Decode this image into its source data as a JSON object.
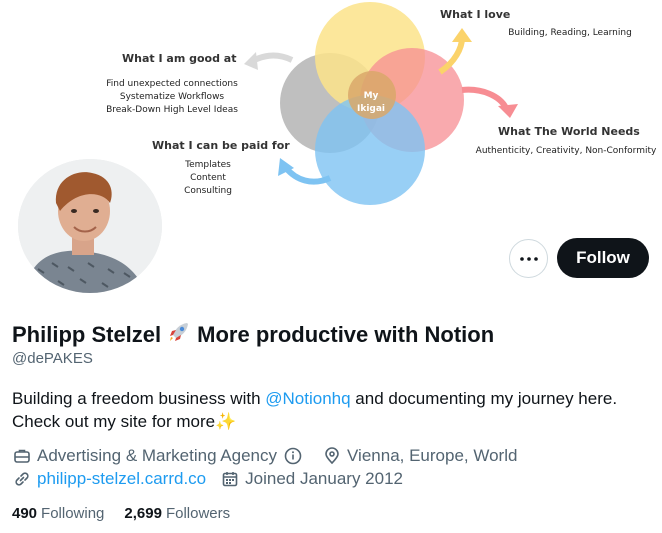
{
  "banner": {
    "good_at": {
      "heading": "What I am  good at",
      "lines": [
        "Find unexpected connections",
        "Systematize Workflows",
        "Break-Down High Level Ideas"
      ]
    },
    "love": {
      "heading": "What I love",
      "lines": [
        "Building, Reading, Learning"
      ]
    },
    "paid_for": {
      "heading": "What I can be paid for",
      "lines": [
        "Templates",
        "Content",
        "Consulting"
      ]
    },
    "world_needs": {
      "heading": "What The World Needs",
      "lines": [
        "Authenticity, Creativity, Non-Conformity"
      ]
    },
    "center": [
      "My",
      "Ikigai"
    ],
    "colors": {
      "gray": "#b4b4b4",
      "yellow": "#fbe38a",
      "pink": "#f78d93",
      "blue": "#7ec3f2",
      "orange": "#f9b36a"
    }
  },
  "profile": {
    "name": "Philipp Stelzel",
    "name_suffix": "More productive with Notion",
    "handle": "@dePAKES",
    "bio_before": "Building a freedom business with ",
    "bio_mention": "@Notionhq",
    "bio_after": " and documenting my journey here. Check out my site for more",
    "bio_emoji": "✨",
    "category": "Advertising & Marketing Agency",
    "location": "Vienna, Europe, World",
    "website": "philipp-stelzel.carrd.co",
    "joined": "Joined January 2012",
    "following_count": "490",
    "following_label": "Following",
    "followers_count": "2,699",
    "followers_label": "Followers"
  },
  "actions": {
    "follow_label": "Follow",
    "more_icon": "more-dots-icon"
  },
  "accent_color": "#1d9bf0"
}
